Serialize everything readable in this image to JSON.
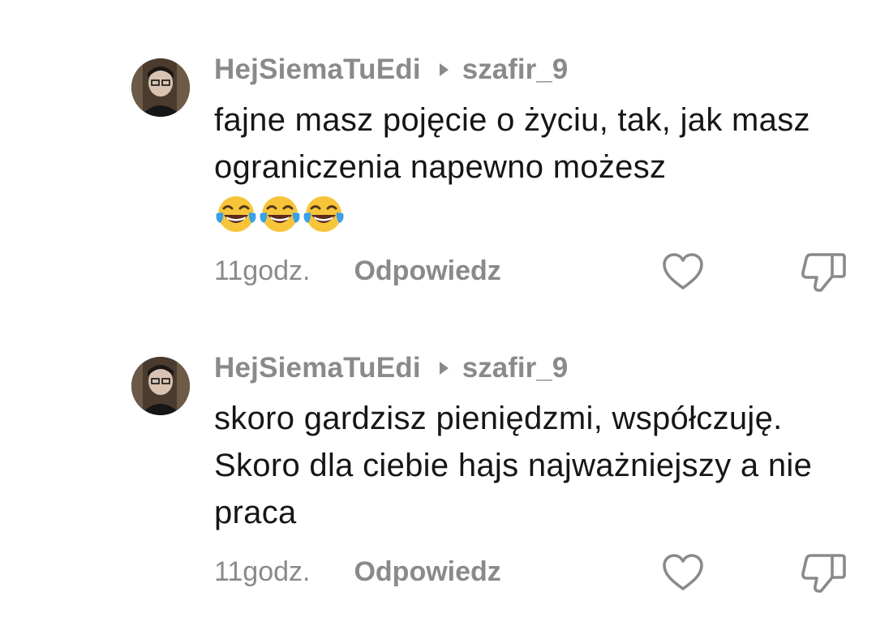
{
  "comments": [
    {
      "username": "HejSiemaTuEdi",
      "reply_to": "szafir_9",
      "text": "fajne masz pojęcie o życiu, tak, jak masz ograniczenia napewno możesz",
      "emojis": [
        "face-with-tears-of-joy",
        "face-with-tears-of-joy",
        "face-with-tears-of-joy"
      ],
      "time": "11godz.",
      "reply_label": "Odpowiedz"
    },
    {
      "username": "HejSiemaTuEdi",
      "reply_to": "szafir_9",
      "text": "skoro gardzisz pieniędzmi, współczuję. Skoro dla ciebie hajs najważniejszy a nie praca",
      "time": "11godz.",
      "reply_label": "Odpowiedz"
    }
  ],
  "icons": {
    "like": "heart-outline-icon",
    "dislike": "thumbs-down-outline-icon"
  },
  "colors": {
    "meta_gray": "#8a8a8a",
    "text": "#161616",
    "background": "#ffffff"
  }
}
